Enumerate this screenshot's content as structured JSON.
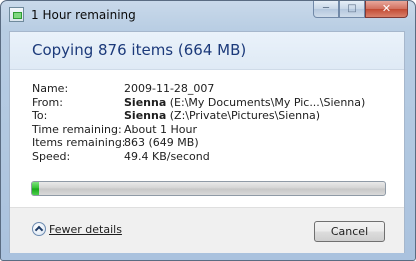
{
  "window": {
    "title": "1 Hour remaining",
    "icon": "copy-progress-icon",
    "caption_buttons": [
      "minimize-icon",
      "maximize-icon",
      "close-icon"
    ]
  },
  "dialog": {
    "heading": "Copying 876 items (664 MB)",
    "details": {
      "name_label": "Name:",
      "name_value": "2009-11-28_007",
      "from_label": "From:",
      "from_bold": "Sienna",
      "from_path": " (E:\\My Documents\\My Pic...\\Sienna)",
      "to_label": "To:",
      "to_bold": "Sienna",
      "to_path": " (Z:\\Private\\Pictures\\Sienna)",
      "time_label": "Time remaining:",
      "time_value": "About 1 Hour",
      "items_label": "Items remaining:",
      "items_value": "863 (649 MB)",
      "speed_label": "Speed:",
      "speed_value": "49.4 KB/second"
    },
    "progress_percent": 2,
    "progress_color": "#2fbf2f",
    "fewer_details_label": "Fewer details",
    "cancel_label": "Cancel"
  }
}
